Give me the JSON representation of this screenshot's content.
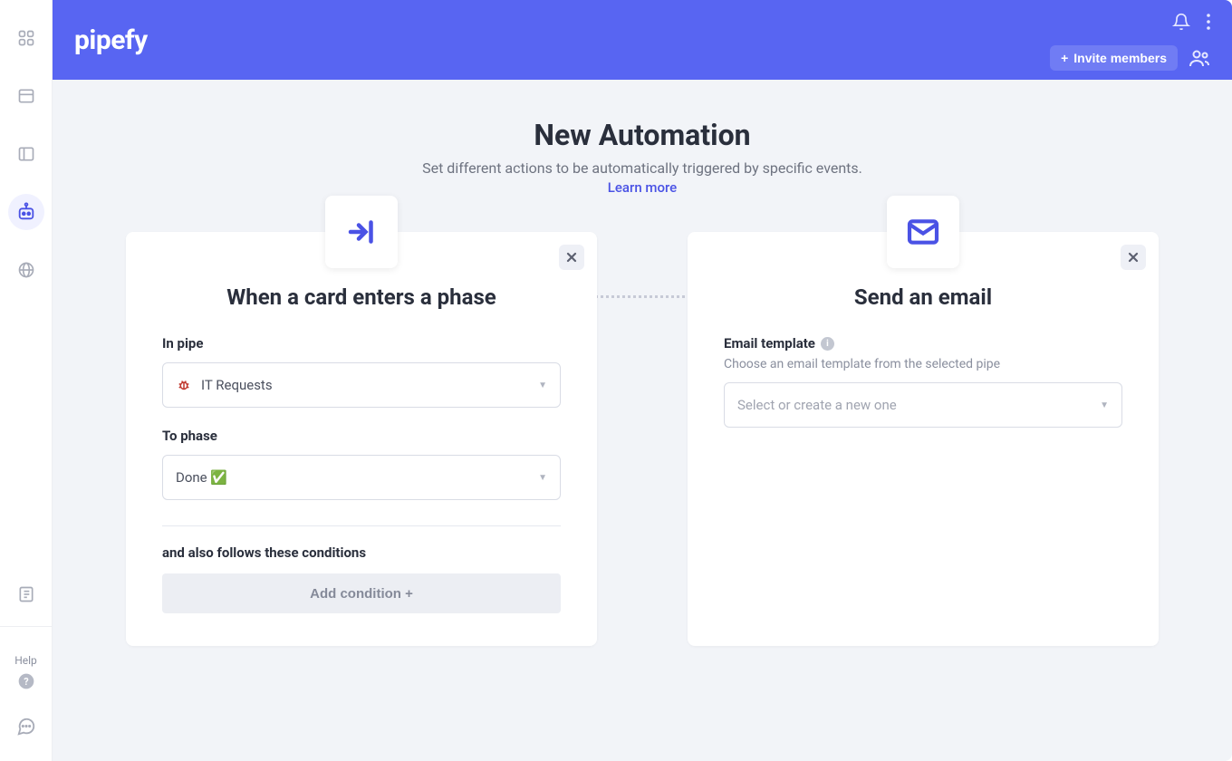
{
  "brand": "pipefy",
  "header": {
    "invite_label": "Invite members"
  },
  "sidebar": {
    "help_label": "Help"
  },
  "page": {
    "title": "New Automation",
    "subtitle": "Set different actions to be automatically triggered by specific events.",
    "learn_more": "Learn more"
  },
  "trigger_card": {
    "title": "When a card enters a phase",
    "in_pipe_label": "In pipe",
    "in_pipe_value": "IT Requests",
    "to_phase_label": "To phase",
    "to_phase_value": "Done ✅",
    "conditions_label": "and also follows these conditions",
    "add_condition_label": "Add condition +"
  },
  "action_card": {
    "title": "Send an email",
    "template_label": "Email template",
    "template_sub": "Choose an email template from the selected pipe",
    "template_placeholder": "Select or create a new one"
  }
}
